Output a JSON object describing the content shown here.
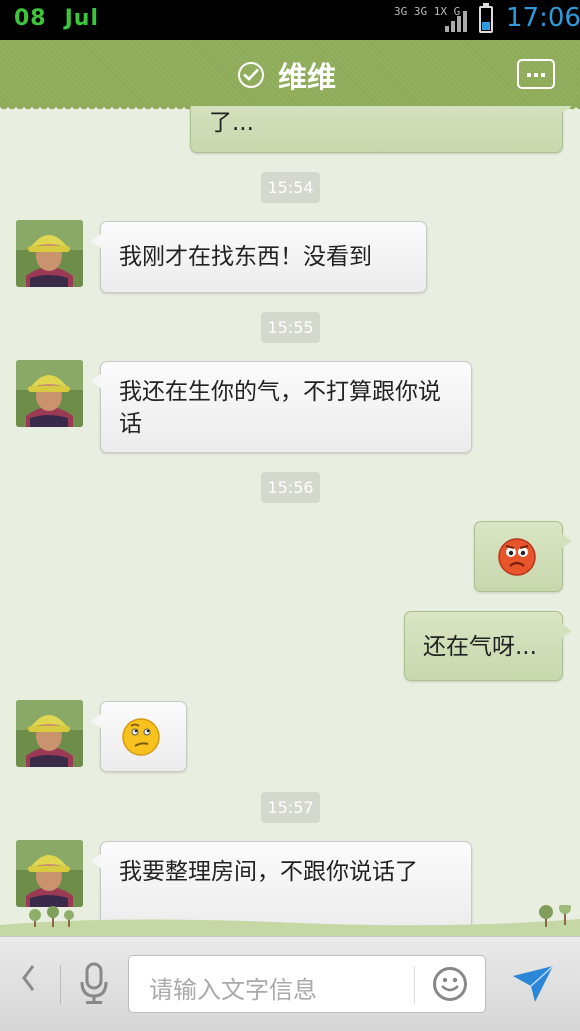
{
  "status_bar": {
    "day": "08",
    "month": "Jul",
    "network_labels": [
      "3G",
      "3G",
      "1X",
      "G"
    ],
    "time": "17:06",
    "battery_level": 0.35
  },
  "header": {
    "title": "维维",
    "verified_icon": "check-circle-icon",
    "menu_icon": "more-icon"
  },
  "chat": {
    "partial_message": "了...",
    "timestamps": [
      "15:54",
      "15:55",
      "15:56",
      "15:57"
    ],
    "messages": [
      {
        "from": "them",
        "text": "我刚才在找东西！没看到"
      },
      {
        "from": "them",
        "text": "我还在生你的气，不打算跟你说话"
      },
      {
        "from": "me",
        "emoji": "angry-face-icon"
      },
      {
        "from": "me",
        "text": "还在气呀..."
      },
      {
        "from": "them",
        "emoji": "confused-face-icon"
      },
      {
        "from": "them",
        "text": "我要整理房间，不跟你说话了"
      }
    ]
  },
  "input_bar": {
    "back_icon": "chevron-left-icon",
    "voice_icon": "microphone-icon",
    "placeholder": "请输入文字信息",
    "emoji_icon": "smiley-icon",
    "send_icon": "send-icon"
  },
  "colors": {
    "header_green": "#8dab58",
    "background": "#e8efe0",
    "outgoing_bubble": "#d1dfba",
    "incoming_bubble": "#f4f4f4",
    "status_time_blue": "#2d9bdb",
    "date_green": "#3ec53e"
  }
}
